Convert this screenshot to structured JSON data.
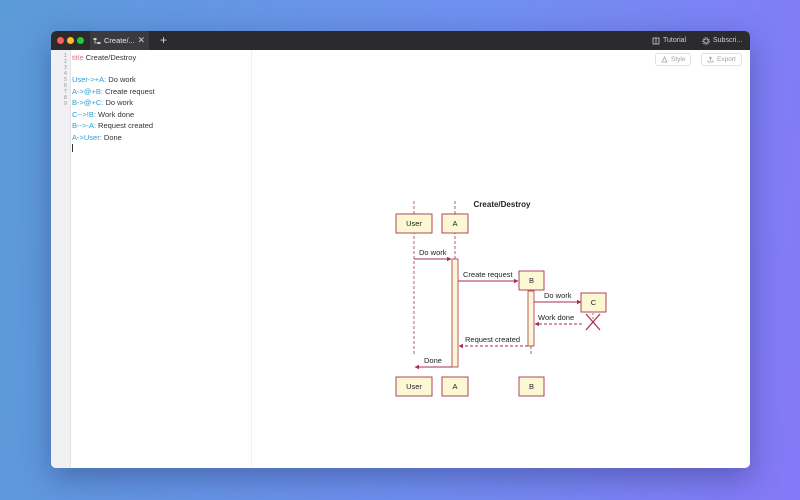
{
  "titlebar": {
    "tab_label": "Create/...",
    "tab_close": "✕",
    "new_tab": "+",
    "tutorial_label": "Tutorial",
    "subscribe_label": "Subscri..."
  },
  "editor": {
    "line_numbers": [
      "1",
      "2",
      "3",
      "4",
      "5",
      "6",
      "7",
      "8",
      "9"
    ],
    "lines": [
      {
        "parts": [
          {
            "text": "title",
            "cls": "kw"
          },
          {
            "text": " Create/Destroy",
            "cls": ""
          }
        ]
      },
      {
        "parts": []
      },
      {
        "parts": [
          {
            "text": "User->+A:",
            "cls": "ar"
          },
          {
            "text": " Do work",
            "cls": ""
          }
        ]
      },
      {
        "parts": [
          {
            "text": "A->@+B:",
            "cls": "ar"
          },
          {
            "text": " Create request",
            "cls": ""
          }
        ]
      },
      {
        "parts": [
          {
            "text": "B->@+C:",
            "cls": "ar"
          },
          {
            "text": " Do work",
            "cls": ""
          }
        ]
      },
      {
        "parts": [
          {
            "text": "C-->!B:",
            "cls": "ar"
          },
          {
            "text": " Work done",
            "cls": ""
          }
        ]
      },
      {
        "parts": [
          {
            "text": "B-->-A:",
            "cls": "ar"
          },
          {
            "text": " Request created",
            "cls": ""
          }
        ]
      },
      {
        "parts": [
          {
            "text": "A->User:",
            "cls": "ar"
          },
          {
            "text": " Done",
            "cls": ""
          }
        ]
      }
    ]
  },
  "toolbar": {
    "style_label": "Style",
    "export_label": "Export"
  },
  "diagram": {
    "title": "Create/Destroy",
    "participants": {
      "user": "User",
      "a": "A",
      "b": "B",
      "c": "C"
    },
    "messages": {
      "m1": "Do work",
      "m2": "Create request",
      "m3": "Do work",
      "m4": "Work done",
      "m5": "Request created",
      "m6": "Done"
    },
    "colors": {
      "box_fill": "#fdf8d4",
      "stroke": "#a8324a",
      "text": "#222222"
    }
  }
}
